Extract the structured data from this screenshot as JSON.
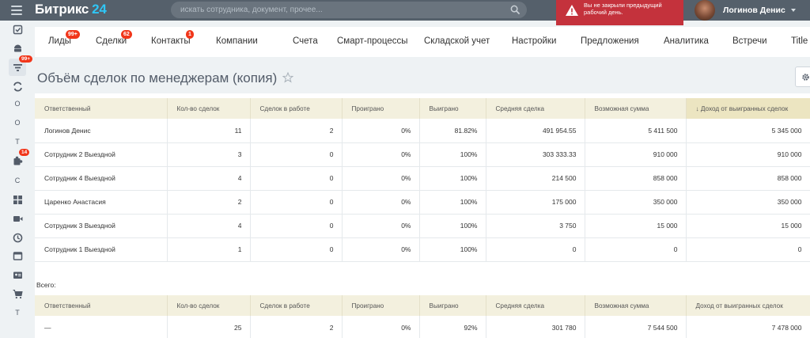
{
  "header": {
    "logo_text": "Битрикс",
    "logo_num": "24",
    "search_placeholder": "искать сотрудника, документ, прочее...",
    "warning_text": "Вы не закрыли предыдущий рабочий день.",
    "user_name": "Логинов Денис"
  },
  "sidebar": {
    "items": [
      {
        "icon": "checkbox-icon",
        "label": ""
      },
      {
        "icon": "android-icon",
        "label": ""
      },
      {
        "icon": "filter-icon",
        "label": "",
        "badge": "99+"
      },
      {
        "icon": "sync-icon",
        "label": ""
      },
      {
        "icon": "letter-icon",
        "label": "О"
      },
      {
        "icon": "letter-icon",
        "label": "О"
      },
      {
        "icon": "letter-icon",
        "label": "Т"
      },
      {
        "icon": "puzzle-icon",
        "label": "",
        "badge": "14"
      },
      {
        "icon": "letter-icon",
        "label": "С"
      },
      {
        "icon": "grid-icon",
        "label": ""
      },
      {
        "icon": "video-icon",
        "label": ""
      },
      {
        "icon": "clock-icon",
        "label": ""
      },
      {
        "icon": "window-icon",
        "label": ""
      },
      {
        "icon": "contact-card-icon",
        "label": ""
      },
      {
        "icon": "cart-icon",
        "label": ""
      },
      {
        "icon": "letter-icon",
        "label": "Т"
      }
    ]
  },
  "nav": {
    "tabs": [
      {
        "label": "Лиды",
        "badge": "99+"
      },
      {
        "label": "Сделки",
        "badge": "62"
      },
      {
        "label": "Контакты",
        "badge": "1"
      },
      {
        "label": "Компании"
      },
      {
        "label": "Счета"
      },
      {
        "label": "Смарт-процессы"
      },
      {
        "label": "Складской учет"
      },
      {
        "label": "Настройки"
      },
      {
        "label": "Предложения"
      },
      {
        "label": "Аналитика"
      },
      {
        "label": "Встречи"
      },
      {
        "label": "Title"
      }
    ]
  },
  "page": {
    "title": "Объём сделок по менеджерам (копия)"
  },
  "report": {
    "columns": [
      "Ответственный",
      "Кол-во сделок",
      "Сделок в работе",
      "Проиграно",
      "Выиграно",
      "Средняя сделка",
      "Возможная сумма",
      "↓ Доход от выигранных сделок"
    ],
    "rows": [
      [
        "Логинов Денис",
        "11",
        "2",
        "0%",
        "81.82%",
        "491 954.55",
        "5 411 500",
        "5 345 000"
      ],
      [
        "Сотрудник 2 Выездной",
        "3",
        "0",
        "0%",
        "100%",
        "303 333.33",
        "910 000",
        "910 000"
      ],
      [
        "Сотрудник 4 Выездной",
        "4",
        "0",
        "0%",
        "100%",
        "214 500",
        "858 000",
        "858 000"
      ],
      [
        "Царенко Анастасия",
        "2",
        "0",
        "0%",
        "100%",
        "175 000",
        "350 000",
        "350 000"
      ],
      [
        "Сотрудник 3 Выездной",
        "4",
        "0",
        "0%",
        "100%",
        "3 750",
        "15 000",
        "15 000"
      ],
      [
        "Сотрудник 1 Выездной",
        "1",
        "0",
        "0%",
        "100%",
        "0",
        "0",
        "0"
      ]
    ],
    "total_label": "Всего:",
    "total_columns": [
      "Ответственный",
      "Кол-во сделок",
      "Сделок в работе",
      "Проиграно",
      "Выиграно",
      "Средняя сделка",
      "Возможная сумма",
      "Доход от выигранных сделок"
    ],
    "total_row": [
      "—",
      "25",
      "2",
      "0%",
      "92%",
      "301 780",
      "7 544 500",
      "7 478 000"
    ]
  },
  "colors": {
    "topbar": "#55606b",
    "accent": "#2fc6f6",
    "warning": "#c4323c",
    "header_row": "#f3f0de",
    "badge": "#f1361a"
  }
}
